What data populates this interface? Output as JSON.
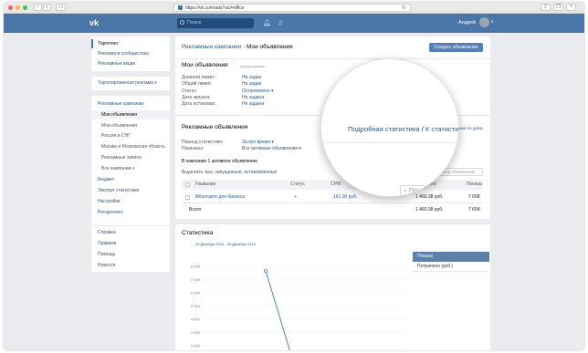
{
  "browser": {
    "url": "https://vk.com/ads?act=office"
  },
  "header": {
    "search_placeholder": "Поиск",
    "user_name": "Андрей"
  },
  "nav": {
    "group1": [
      "Таргетинг",
      "Реклама в сообществах",
      "Рекламные акции"
    ],
    "group2": [
      "Таргетированная реклама"
    ],
    "group3": [
      "Рекламные кампании"
    ],
    "group3_sub": [
      "Мои объявления",
      "Мои объявления",
      "Россия и СНГ",
      "Москва и Московская область",
      "Рекламные записи",
      "Все кампании"
    ],
    "group3_rest": [
      "Бюджет",
      "Экспорт статистики",
      "Настройки",
      "Ретаргетинг"
    ],
    "group4": [
      "Справка",
      "Правила",
      "Помощь",
      "Новости"
    ]
  },
  "page": {
    "breadcrumb_root": "Рекламные кампании",
    "breadcrumb_sep": "›",
    "breadcrumb_current": "Мои объявления",
    "create_button": "Создать объявление"
  },
  "my_ads": {
    "title": "Мои объявления",
    "edit_note": "редактировать",
    "fields": [
      {
        "label": "Дневной лимит:",
        "value": "Не задан"
      },
      {
        "label": "Общий лимит:",
        "value": "Не задан"
      },
      {
        "label": "Статус:",
        "value": "Остановлено"
      },
      {
        "label": "Дата запуска:",
        "value": "Не задана"
      },
      {
        "label": "Дата остановки:",
        "value": "Не задана"
      }
    ]
  },
  "ads": {
    "title": "Рекламные объявления",
    "stats_link": "Подробная статистика",
    "stats_sep": "/",
    "stats_link2": "К статистике по дням",
    "period_label": "Период статистики:",
    "period_value": "За всё время",
    "show_label": "Показаны:",
    "show_value": "Все активные объявления",
    "summary": "В кампании 1 активное объявление",
    "select_label": "Выделить:",
    "select_all": "все",
    "select_running": "запущенные",
    "select_stopped": "остановленные",
    "filter_placeholder": "Фильтр объявлений",
    "columns": {
      "name": "Название",
      "status": "Статус",
      "cpm": "CPM",
      "spent": "Потрачено",
      "views": "Показы"
    },
    "rows": [
      {
        "name": "ВКонтакте для бизнеса",
        "cpm": "161.00 руб.",
        "spent": "1 460.38 руб.",
        "views": "7 658"
      }
    ],
    "total": {
      "label": "Всего",
      "spent": "1 460.38 руб.",
      "views": "7 658"
    }
  },
  "magnifier": {
    "text1": "Подробная статистика",
    "sep": "/",
    "text2": "К статистике",
    "text3": "Пока"
  },
  "stats": {
    "title": "Статистика",
    "legend": [
      "Показы",
      "Потрачено (руб.)"
    ]
  },
  "chart_data": {
    "type": "line",
    "title": "23 Декабря 2016 - 25 Декабря 2016",
    "y_ticks": [
      "8 000",
      "7 000",
      "6 000",
      "5 000",
      "4 000",
      "3 000",
      "2 000"
    ],
    "ylim": [
      1500,
      8000
    ],
    "series": [
      {
        "name": "Показы",
        "points": [
          [
            0,
            7658
          ],
          [
            1,
            1500
          ]
        ]
      }
    ],
    "colors": {
      "line": "#5181b8",
      "grid": "#eef0f3"
    }
  },
  "theme": {
    "vk_blue": "#4a76a8",
    "button_blue": "#5181b8",
    "link": "#2a5885",
    "legend_active": "#5e7fa6"
  }
}
